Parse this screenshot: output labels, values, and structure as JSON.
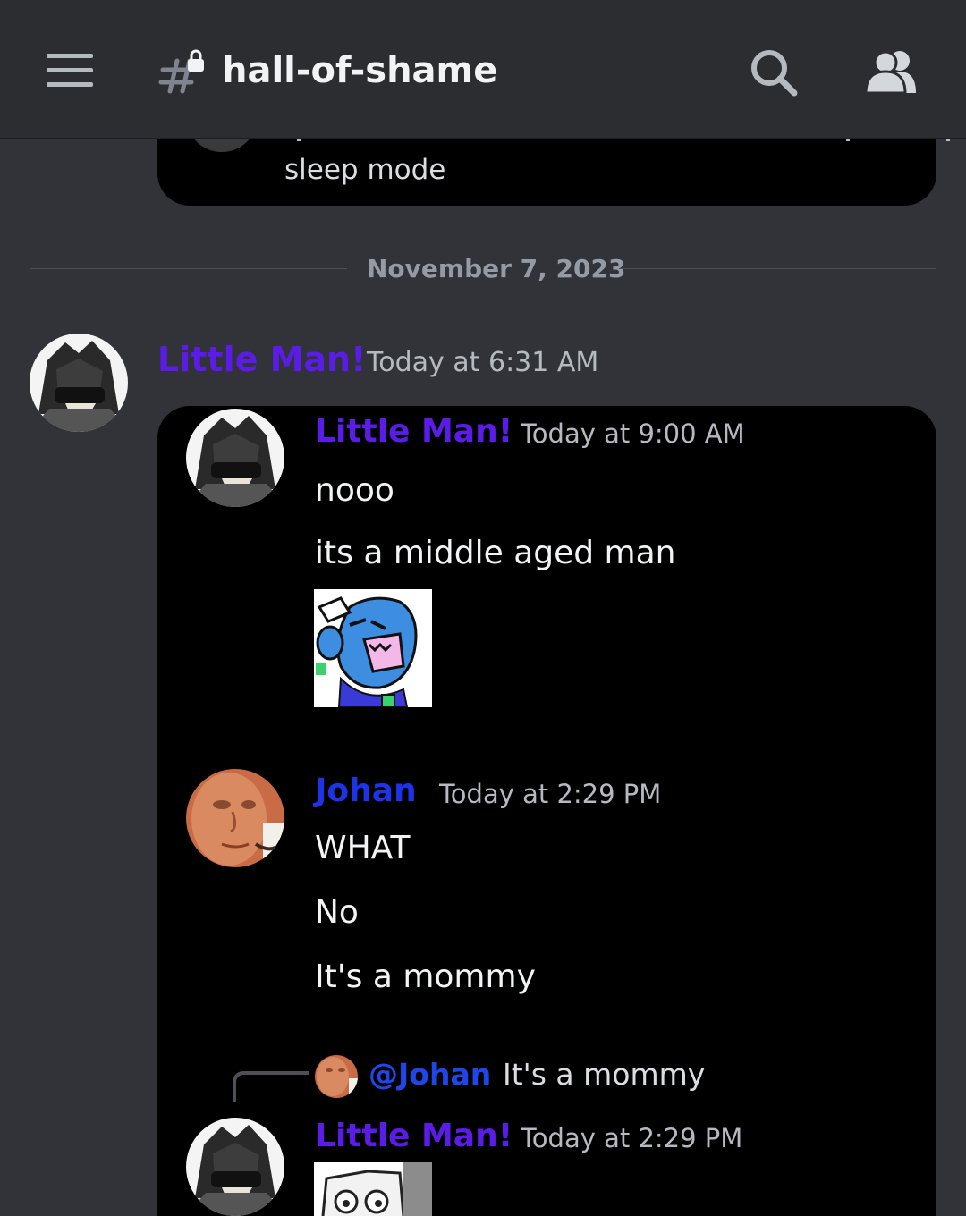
{
  "header": {
    "channel_name": "hall-of-shame",
    "icons": [
      "hamburger-menu-icon",
      "locked-channel-hash-icon",
      "search-icon",
      "members-icon"
    ]
  },
  "previous_embed": {
    "text": "sleep mode"
  },
  "date_divider": "November 7, 2023",
  "message": {
    "author": "Little Man!",
    "timestamp": "Today at 6:31 AM",
    "author_color": "#5b1ce8",
    "quoted": [
      {
        "author": "Little Man!",
        "timestamp": "Today at 9:00 AM",
        "author_color": "#5b1ce8",
        "lines": [
          "nooo",
          "its a middle aged man"
        ],
        "has_sticker": true
      },
      {
        "author": "Johan",
        "timestamp": "Today at 2:29 PM",
        "author_color": "#1e32e8",
        "lines": [
          "WHAT",
          "No",
          "It's a mommy"
        ]
      },
      {
        "reply_to_mention": "@Johan",
        "reply_to_text": "It's a mommy",
        "author": "Little Man!",
        "timestamp": "Today at 2:29 PM",
        "author_color": "#5b1ce8",
        "has_sticker": true
      }
    ]
  },
  "colors": {
    "background": "#313338",
    "header": "#2b2d31",
    "embed": "#000000",
    "muted_text": "#b5bac1"
  }
}
